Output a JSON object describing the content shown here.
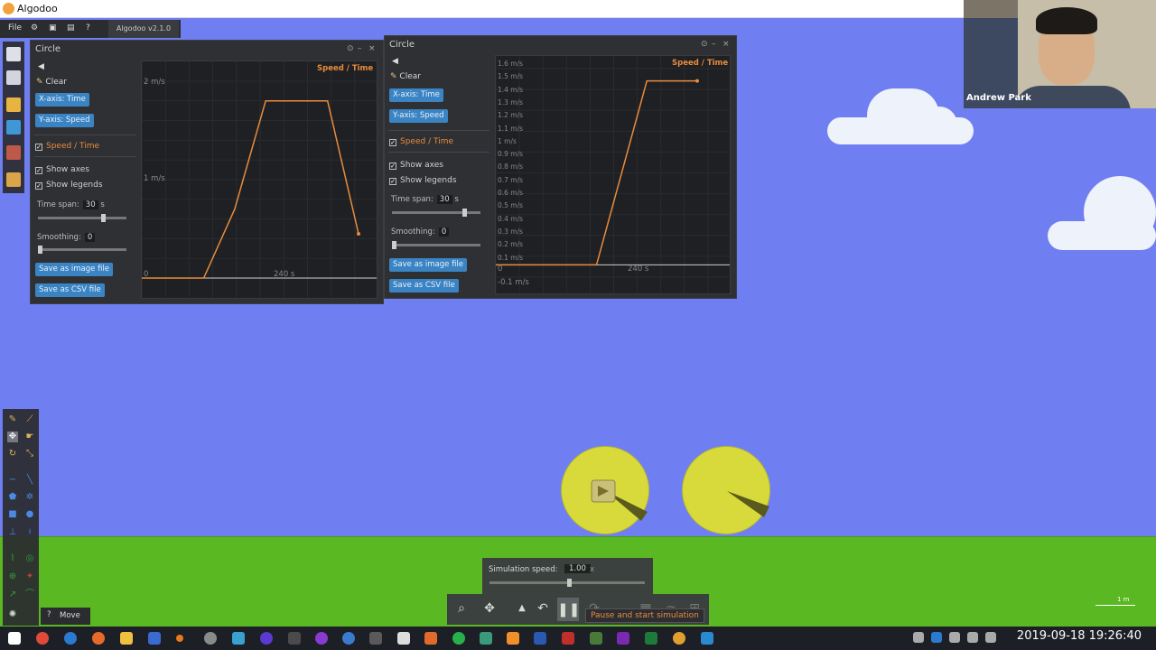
{
  "window": {
    "title": "Algodoo"
  },
  "menubar": {
    "file": "File",
    "version": "Algodoo v2.1.0"
  },
  "graph_left": {
    "title": "Circle",
    "clear": "Clear",
    "x_axis_btn": "X-axis: Time",
    "y_axis_btn": "Y-axis: Speed",
    "series_label": "Speed / Time",
    "show_axes": "Show axes",
    "show_legends": "Show legends",
    "time_span_label": "Time span:",
    "time_span_value": "30",
    "time_span_unit": "s",
    "smoothing_label": "Smoothing:",
    "smoothing_value": "0",
    "save_image": "Save as image file",
    "save_csv": "Save as CSV file",
    "plot_label": "Speed / Time",
    "tick_top": "2 m/s",
    "tick_mid": "1 m/s",
    "tick_zero": "0",
    "tick_x": "240 s"
  },
  "graph_right": {
    "title": "Circle",
    "clear": "Clear",
    "x_axis_btn": "X-axis: Time",
    "y_axis_btn": "Y-axis: Speed",
    "series_label": "Speed / Time",
    "show_axes": "Show axes",
    "show_legends": "Show legends",
    "time_span_label": "Time span:",
    "time_span_value": "30",
    "time_span_unit": "s",
    "smoothing_label": "Smoothing:",
    "smoothing_value": "0",
    "save_image": "Save as image file",
    "save_csv": "Save as CSV file",
    "plot_label": "Speed / Time",
    "ticks": [
      "1.6 m/s",
      "1.5 m/s",
      "1.4 m/s",
      "1.3 m/s",
      "1.2 m/s",
      "1.1 m/s",
      "1 m/s",
      "0.9 m/s",
      "0.8 m/s",
      "0.7 m/s",
      "0.6 m/s",
      "0.5 m/s",
      "0.4 m/s",
      "0.3 m/s",
      "0.2 m/s",
      "0.1 m/s"
    ],
    "tick_zero": "0",
    "tick_x": "240 s",
    "tick_neg": "-0.1 m/s"
  },
  "chart_data": [
    {
      "type": "line",
      "title": "Speed / Time",
      "xlabel": "",
      "ylabel": "",
      "ylim": [
        0,
        2
      ],
      "x": [
        0,
        1,
        2,
        3,
        4,
        5,
        6,
        7
      ],
      "series": [
        {
          "values": [
            0,
            0,
            0,
            0.7,
            1.8,
            1.8,
            1.8,
            0.45
          ]
        }
      ]
    },
    {
      "type": "line",
      "title": "Speed / Time",
      "xlabel": "",
      "ylabel": "",
      "ylim": [
        -0.1,
        1.6
      ],
      "x": [
        0,
        1,
        2,
        3,
        4
      ],
      "series": [
        {
          "values": [
            0,
            0,
            0,
            1.5,
            1.5
          ]
        }
      ]
    }
  ],
  "simulation": {
    "speed_label": "Simulation speed:",
    "speed_value": "1.00",
    "speed_unit": "x",
    "tooltip": "Pause and start simulation"
  },
  "toolstrip": {
    "move_label": "Move"
  },
  "webcam": {
    "name": "Andrew Park"
  },
  "scale": {
    "label": "1 m"
  },
  "taskbar": {
    "clock": "2019-09-18  19:26:40"
  },
  "colors": {
    "sky": "#6f7ff2",
    "ground": "#5ab823",
    "accent": "#e88c3d",
    "button": "#3b84c4",
    "circle": "#d8da3c"
  }
}
